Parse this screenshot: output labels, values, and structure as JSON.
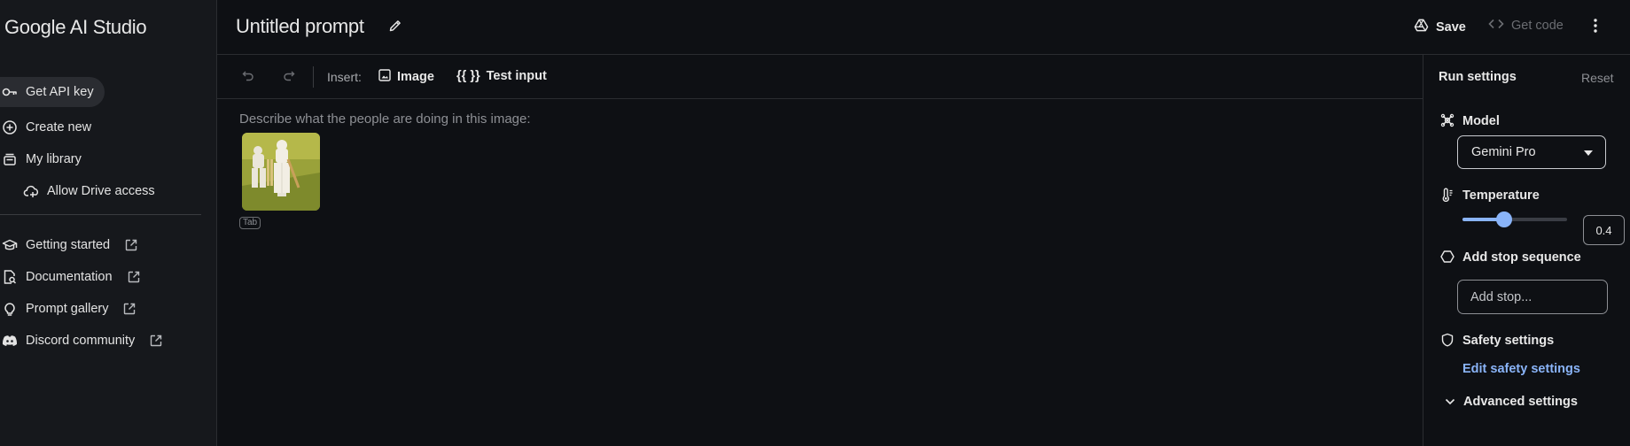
{
  "app": {
    "title": "Google AI Studio"
  },
  "sidebar": {
    "items": [
      {
        "label": "Get API key",
        "icon": "key-icon",
        "active": true
      },
      {
        "label": "Create new",
        "icon": "add-circle-icon"
      },
      {
        "label": "My library",
        "icon": "library-icon"
      },
      {
        "label": "Allow Drive access",
        "icon": "drive-add-icon"
      }
    ],
    "links": [
      {
        "label": "Getting started",
        "icon": "school-icon"
      },
      {
        "label": "Documentation",
        "icon": "doc-search-icon"
      },
      {
        "label": "Prompt gallery",
        "icon": "lightbulb-icon"
      },
      {
        "label": "Discord community",
        "icon": "discord-icon"
      }
    ]
  },
  "header": {
    "prompt_title": "Untitled prompt",
    "save_label": "Save",
    "get_code_label": "Get code"
  },
  "toolbar": {
    "insert_label": "Insert:",
    "image_label": "Image",
    "test_input_icon": "{{ }}",
    "test_input_label": "Test input"
  },
  "prompt": {
    "text": "Describe what the people are doing in this image:",
    "image_badge": "Tab"
  },
  "run_settings": {
    "title": "Run settings",
    "reset_label": "Reset",
    "model_label": "Model",
    "model_value": "Gemini Pro",
    "temperature_label": "Temperature",
    "temperature_value": "0.4",
    "temperature_fraction": 0.4,
    "stop_sequence_label": "Add stop sequence",
    "stop_placeholder": "Add stop...",
    "safety_label": "Safety settings",
    "safety_link": "Edit safety settings",
    "advanced_label": "Advanced settings"
  },
  "colors": {
    "background": "#0e1014",
    "sidebar": "#16181c",
    "accent": "#8ab4f8"
  }
}
